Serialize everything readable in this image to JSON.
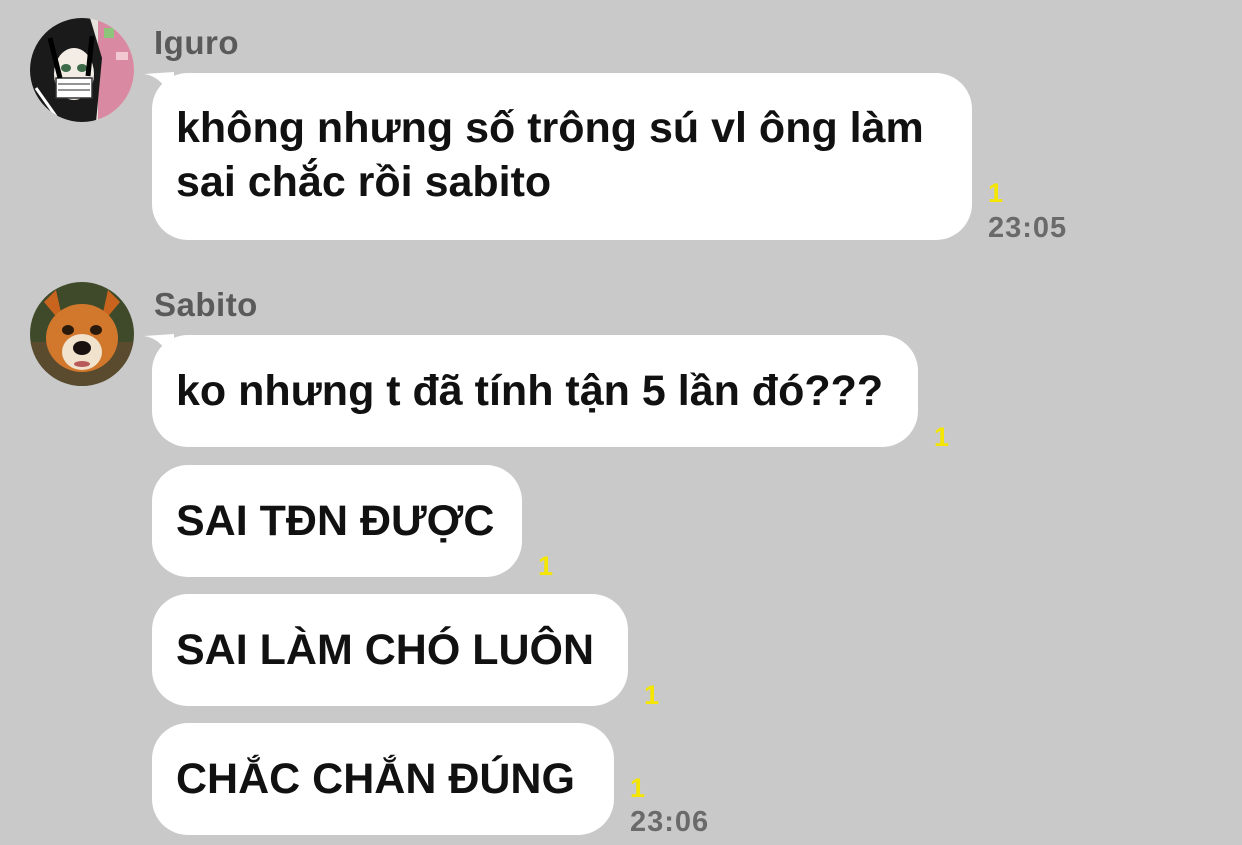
{
  "messages_group_1": {
    "sender": "Iguro",
    "bubbles": [
      {
        "text_line1": "không nhưng số trông sú vl ông làm",
        "text_line2": "sai chắc rồi sabito",
        "read": "1"
      }
    ],
    "time": "23:05"
  },
  "messages_group_2": {
    "sender": "Sabito",
    "bubbles": [
      {
        "text": "ko nhưng t đã tính tận 5 lần đó???",
        "read": "1"
      },
      {
        "text": "SAI TĐN ĐƯỢC",
        "read": "1"
      },
      {
        "text": "SAI LÀM CHÓ LUÔN",
        "read": "1"
      },
      {
        "text": "CHẮC CHẮN ĐÚNG",
        "read": "1"
      }
    ],
    "time": "23:06"
  },
  "colors": {
    "background": "#c9c9c9",
    "bubble": "#ffffff",
    "read_receipt": "#f4e600",
    "sender_text": "#5a5a5a"
  }
}
